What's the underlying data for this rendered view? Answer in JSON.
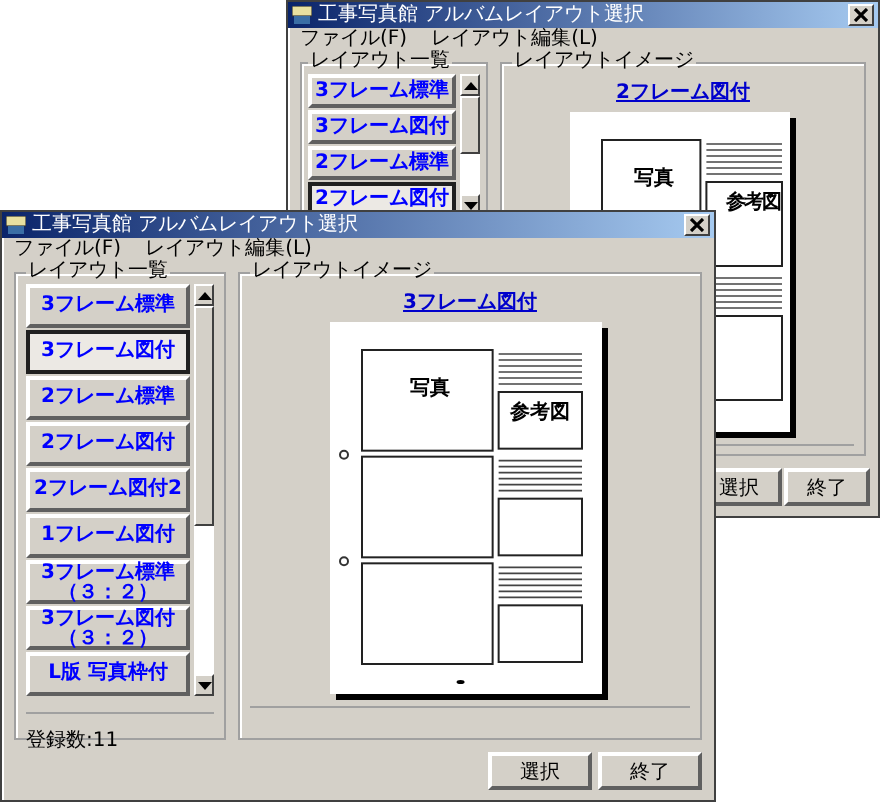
{
  "windows": [
    {
      "kind": "back",
      "title": "工事写真館 アルバムレイアウト選択",
      "menu": [
        "ファイル(F)",
        "レイアウト編集(L)"
      ],
      "layout_group": {
        "label": "レイアウト一覧",
        "items": [
          {
            "label": "3フレーム標準",
            "selected": false
          },
          {
            "label": "3フレーム図付",
            "selected": false
          },
          {
            "label": "2フレーム標準",
            "selected": false
          },
          {
            "label": "2フレーム図付",
            "selected": true
          }
        ]
      },
      "image_group": {
        "label": "レイアウトイメージ",
        "layout_title": "2フレーム図付",
        "frames": [
          {
            "kind": "photo_figure",
            "photo_text": "写真",
            "figure_text": "参考図"
          },
          {
            "kind": "photo_figure"
          }
        ]
      },
      "buttons": [
        "選択",
        "終了"
      ]
    },
    {
      "kind": "front",
      "title": "工事写真館 アルバムレイアウト選択",
      "menu": [
        "ファイル(F)",
        "レイアウト編集(L)"
      ],
      "layout_group": {
        "label": "レイアウト一覧",
        "items": [
          {
            "label": "3フレーム標準",
            "selected": false
          },
          {
            "label": "3フレーム図付",
            "selected": true
          },
          {
            "label": "2フレーム標準",
            "selected": false
          },
          {
            "label": "2フレーム図付",
            "selected": false
          },
          {
            "label": "2フレーム図付2",
            "selected": false
          },
          {
            "label": "1フレーム図付",
            "selected": false
          },
          {
            "label": "3フレーム標準（３：２）",
            "selected": false
          },
          {
            "label": "3フレーム図付（３：２）",
            "selected": false
          },
          {
            "label": "L版 写真枠付",
            "selected": false
          }
        ],
        "count": "登録数:11"
      },
      "image_group": {
        "label": "レイアウトイメージ",
        "layout_title": "3フレーム図付",
        "frames": [
          {
            "kind": "photo_figure",
            "photo_text": "写真",
            "figure_text": "参考図"
          },
          {
            "kind": "photo_figure"
          },
          {
            "kind": "photo_figure"
          }
        ]
      },
      "buttons": [
        "選択",
        "終了"
      ]
    }
  ]
}
